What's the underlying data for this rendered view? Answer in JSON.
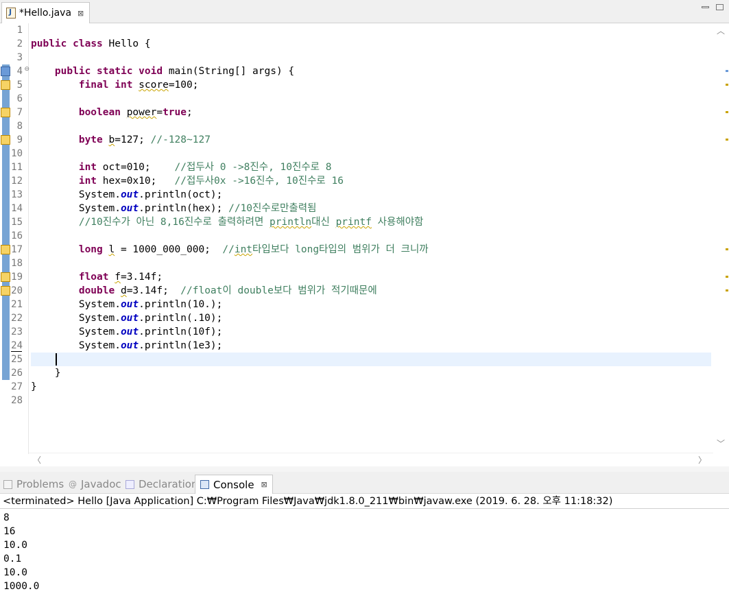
{
  "editor_tab": {
    "title": "*Hello.java",
    "close": "⊠"
  },
  "code_lines": [
    {
      "n": "1",
      "html": ""
    },
    {
      "n": "2",
      "html": "<span class='kw'>public</span> <span class='kw'>class</span> Hello {"
    },
    {
      "n": "3",
      "html": ""
    },
    {
      "n": "4",
      "html": "    <span class='kw'>public</span> <span class='kw'>static</span> <span class='kw'>void</span> main(String[] args) {"
    },
    {
      "n": "5",
      "html": "        <span class='kw'>final</span> <span class='kw'>int</span> <span class='sq'>score</span>=100;"
    },
    {
      "n": "6",
      "html": ""
    },
    {
      "n": "7",
      "html": "        <span class='kw'>boolean</span> <span class='sq'>power</span>=<span class='kw'>true</span>;"
    },
    {
      "n": "8",
      "html": ""
    },
    {
      "n": "9",
      "html": "        <span class='kw'>byte</span> <span class='sq'>b</span>=127; <span class='cm'>//-128~127</span>"
    },
    {
      "n": "10",
      "html": ""
    },
    {
      "n": "11",
      "html": "        <span class='kw'>int</span> oct=010;    <span class='cm'>//접두사 0 -&gt;8진수, 10진수로 8</span>"
    },
    {
      "n": "12",
      "html": "        <span class='kw'>int</span> hex=0x10;   <span class='cm'>//접두사0x -&gt;16진수, 10진수로 16</span>"
    },
    {
      "n": "13",
      "html": "        System.<span class='st'>out</span>.println(oct);"
    },
    {
      "n": "14",
      "html": "        System.<span class='st'>out</span>.println(hex); <span class='cm'>//10진수로만출력됨</span>"
    },
    {
      "n": "15",
      "html": "        <span class='cm'>//10진수가 아닌 8,16진수로 출력하려면 <span class='sqk'>println</span>대신 <span class='sqk'>printf</span> 사용해야함</span>"
    },
    {
      "n": "16",
      "html": ""
    },
    {
      "n": "17",
      "html": "        <span class='kw'>long</span> <span class='sq'>l</span> = 1000_000_000;  <span class='cm'>//<span class='sqk'>int</span>타입보다 long타입의 범위가 더 크니까</span>"
    },
    {
      "n": "18",
      "html": ""
    },
    {
      "n": "19",
      "html": "        <span class='kw'>float</span> <span class='sq'>f</span>=3.14f;"
    },
    {
      "n": "20",
      "html": "        <span class='kw'>double</span> <span class='sq'>d</span>=3.14f;  <span class='cm'>//float이 double보다 범위가 적기때문에</span>"
    },
    {
      "n": "21",
      "html": "        System.<span class='st'>out</span>.println(10.);"
    },
    {
      "n": "22",
      "html": "        System.<span class='st'>out</span>.println(.10);"
    },
    {
      "n": "23",
      "html": "        System.<span class='st'>out</span>.println(10f);"
    },
    {
      "n": "24",
      "html": "        System.<span class='st'>out</span>.println(1e3);"
    },
    {
      "n": "25",
      "html": ""
    },
    {
      "n": "26",
      "html": "    }"
    },
    {
      "n": "27",
      "html": "}"
    },
    {
      "n": "28",
      "html": ""
    }
  ],
  "panel_tabs": {
    "problems": "Problems",
    "javadoc": "Javadoc",
    "declaration": "Declaration",
    "console": "Console",
    "console_close": "⊠"
  },
  "console": {
    "header": "<terminated> Hello [Java Application] C:₩Program Files₩Java₩jdk1.8.0_211₩bin₩javaw.exe (2019. 6. 28. 오후 11:18:32)",
    "output": [
      "8",
      "16",
      "10.0",
      "0.1",
      "10.0",
      "1000.0"
    ]
  }
}
